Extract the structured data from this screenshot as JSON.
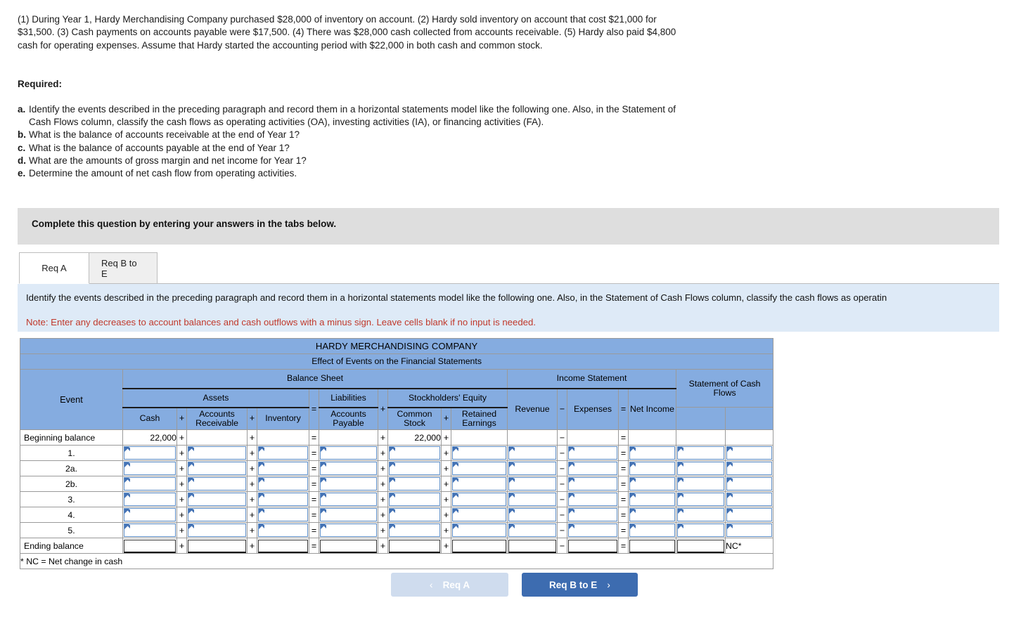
{
  "problem": {
    "text": "(1) During Year 1, Hardy Merchandising Company purchased $28,000 of inventory on account. (2) Hardy sold inventory on account that cost $21,000 for $31,500. (3) Cash payments on accounts payable were $17,500. (4) There was $28,000 cash collected from accounts receivable. (5) Hardy also paid $4,800 cash for operating expenses. Assume that Hardy started the accounting period with $22,000 in both cash and common stock."
  },
  "required": {
    "label": "Required:",
    "items": [
      {
        "letter": "a.",
        "text": "Identify the events described in the preceding paragraph and record them in a horizontal statements model like the following one. Also, in the Statement of Cash Flows column, classify the cash flows as operating activities (OA), investing activities (IA), or financing activities (FA)."
      },
      {
        "letter": "b.",
        "text": "What is the balance of accounts receivable at the end of Year 1?"
      },
      {
        "letter": "c.",
        "text": "What is the balance of accounts payable at the end of Year 1?"
      },
      {
        "letter": "d.",
        "text": "What are the amounts of gross margin and net income for Year 1?"
      },
      {
        "letter": "e.",
        "text": "Determine the amount of net cash flow from operating activities."
      }
    ]
  },
  "gray_banner": {
    "text": "Complete this question by entering your answers in the tabs below."
  },
  "tabs": [
    {
      "label": "Req A",
      "active": true
    },
    {
      "label": "Req B to E",
      "active": false
    }
  ],
  "instruction": {
    "line1": "Identify the events described in the preceding paragraph and record them in a horizontal statements model like the following one. Also, in the Statement of Cash Flows column, classify the cash flows as operatin",
    "note": "Note: Enter any decreases to account balances and cash outflows with a minus sign. Leave cells blank if no input is needed."
  },
  "table": {
    "company": "HARDY MERCHANDISING COMPANY",
    "subtitle": "Effect of Events on the Financial Statements",
    "groups": {
      "balance_sheet": "Balance Sheet",
      "income_statement": "Income Statement",
      "assets": "Assets",
      "liabilities": "Liabilities",
      "stockholders_equity": "Stockholders' Equity",
      "statement_of_cash_flows": "Statement of Cash Flows"
    },
    "columns": {
      "event": "Event",
      "cash": "Cash",
      "accounts_receivable": "Accounts Receivable",
      "inventory": "Inventory",
      "accounts_payable": "Accounts Payable",
      "common_stock": "Common Stock",
      "retained_earnings": "Retained Earnings",
      "revenue": "Revenue",
      "expenses": "Expenses",
      "net_income": "Net Income"
    },
    "operators": {
      "plus": "+",
      "equals": "=",
      "minus": "−"
    },
    "rows": [
      {
        "event": "Beginning balance",
        "type": "begin",
        "cash": "22,000",
        "accounts_receivable": "",
        "inventory": "",
        "accounts_payable": "",
        "common_stock": "22,000",
        "retained_earnings": "",
        "revenue": "",
        "expenses": "",
        "net_income": "",
        "scf": ""
      },
      {
        "event": "1.",
        "type": "input"
      },
      {
        "event": "2a.",
        "type": "input"
      },
      {
        "event": "2b.",
        "type": "input"
      },
      {
        "event": "3.",
        "type": "input"
      },
      {
        "event": "4.",
        "type": "input"
      },
      {
        "event": "5.",
        "type": "input"
      },
      {
        "event": "Ending balance",
        "type": "end",
        "scf": "NC*"
      }
    ],
    "footnote": "* NC = Net change in cash"
  },
  "nav": {
    "prev_label": "Req A",
    "prev_chevron": "‹",
    "next_label": "Req B to E",
    "next_chevron": "›"
  }
}
